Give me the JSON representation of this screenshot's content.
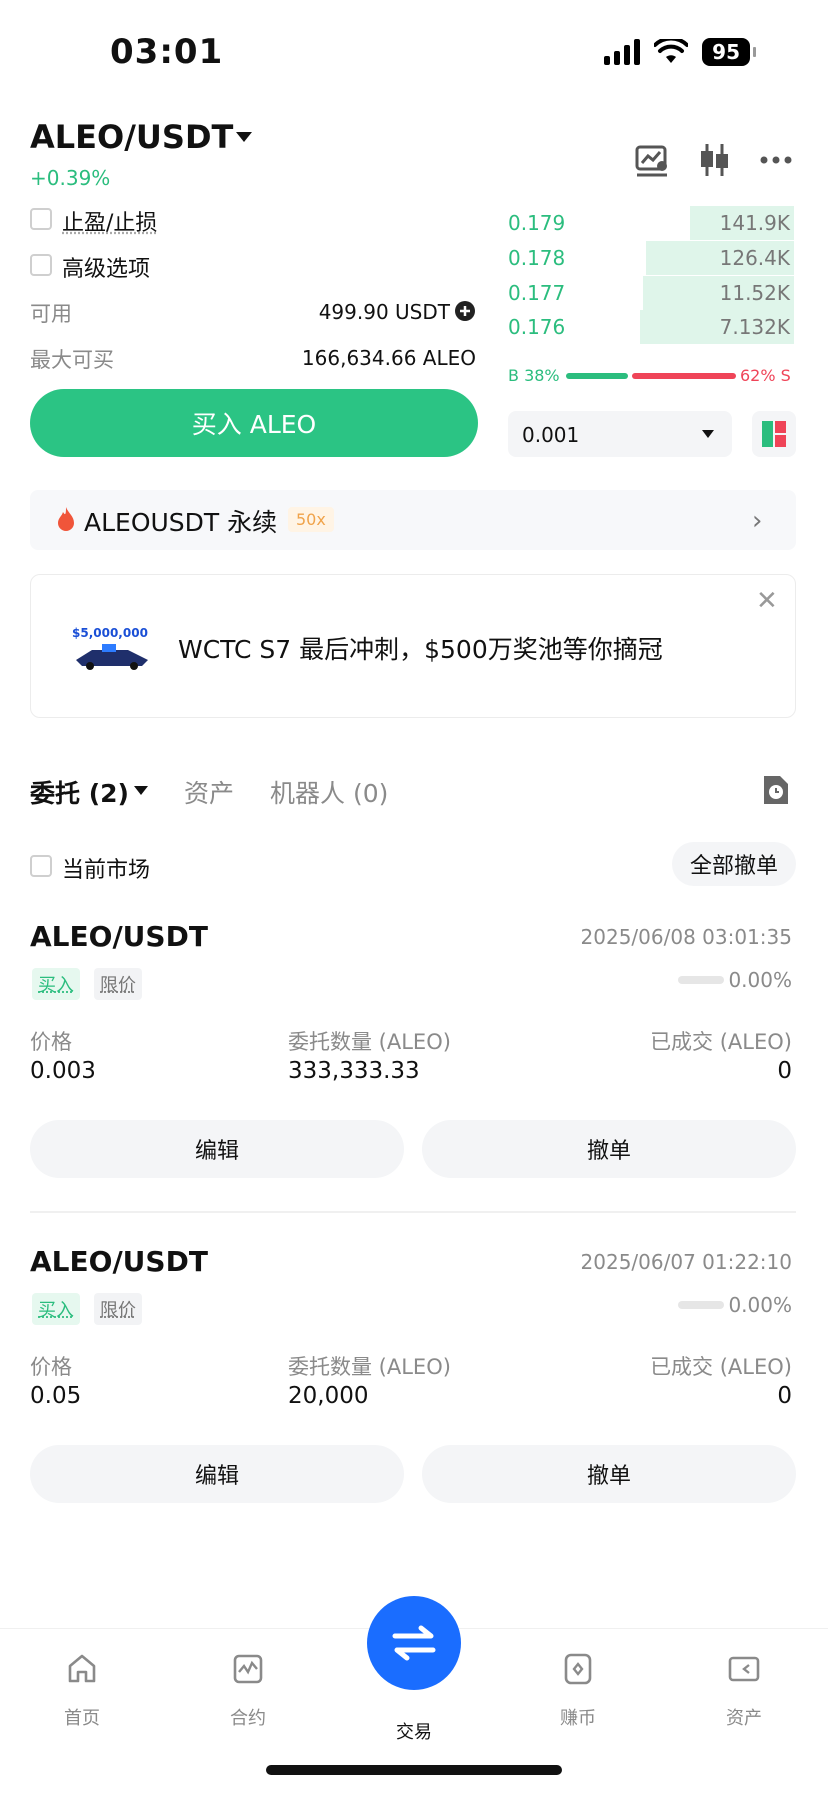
{
  "status_bar": {
    "time": "03:01",
    "battery": "95"
  },
  "header": {
    "pair": "ALEO/USDT",
    "change": "+0.39%"
  },
  "options": {
    "tp_sl": "止盈/止损",
    "advanced": "高级选项"
  },
  "balances": {
    "available_label": "可用",
    "available_value": "499.90 USDT",
    "max_buy_label": "最大可买",
    "max_buy_value": "166,634.66 ALEO"
  },
  "buy_button": "买入 ALEO",
  "order_book": {
    "rows": [
      {
        "price": "0.179",
        "qty": "141.9K",
        "depth": 0.35
      },
      {
        "price": "0.178",
        "qty": "126.4K",
        "depth": 0.5
      },
      {
        "price": "0.177",
        "qty": "11.52K",
        "depth": 0.51
      },
      {
        "price": "0.176",
        "qty": "7.132K",
        "depth": 0.52
      }
    ],
    "buy_ratio": "B 38%",
    "sell_ratio": "62% S",
    "precision": "0.001"
  },
  "perp_banner": {
    "label": "ALEOUSDT 永续",
    "leverage": "50x"
  },
  "promo": {
    "prize_image_text": "$5,000,000",
    "text": "WCTC S7 最后冲刺，$500万奖池等你摘冠"
  },
  "tabs": {
    "orders": "委托 (2)",
    "assets": "资产",
    "bots": "机器人 (0)"
  },
  "filters": {
    "current_market": "当前市场",
    "cancel_all": "全部撤单"
  },
  "orders": [
    {
      "pair": "ALEO/USDT",
      "time": "2025/06/08 03:01:35",
      "side": "买入",
      "type": "限价",
      "progress": "0.00%",
      "price_label": "价格",
      "price": "0.003",
      "qty_label": "委托数量 (ALEO)",
      "qty": "333,333.33",
      "filled_label": "已成交 (ALEO)",
      "filled": "0",
      "edit": "编辑",
      "cancel": "撤单"
    },
    {
      "pair": "ALEO/USDT",
      "time": "2025/06/07 01:22:10",
      "side": "买入",
      "type": "限价",
      "progress": "0.00%",
      "price_label": "价格",
      "price": "0.05",
      "qty_label": "委托数量 (ALEO)",
      "qty": "20,000",
      "filled_label": "已成交 (ALEO)",
      "filled": "0",
      "edit": "编辑",
      "cancel": "撤单"
    }
  ],
  "nav": {
    "home": "首页",
    "futures": "合约",
    "trade": "交易",
    "earn": "赚币",
    "assets": "资产"
  },
  "colors": {
    "green": "#2bbd7e",
    "buy_button": "#2bc484",
    "red": "#ef4458",
    "trade_fab": "#1a6dff"
  }
}
